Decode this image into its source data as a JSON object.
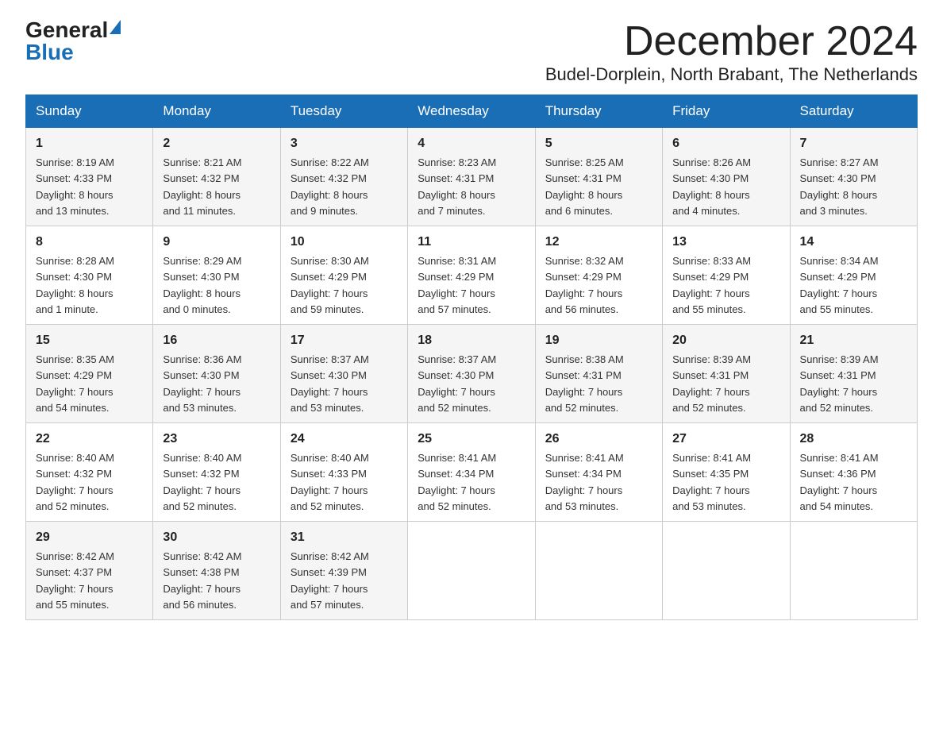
{
  "header": {
    "logo_general": "General",
    "logo_blue": "Blue",
    "month_title": "December 2024",
    "location": "Budel-Dorplein, North Brabant, The Netherlands"
  },
  "days_of_week": [
    "Sunday",
    "Monday",
    "Tuesday",
    "Wednesday",
    "Thursday",
    "Friday",
    "Saturday"
  ],
  "weeks": [
    [
      {
        "day": "1",
        "info": "Sunrise: 8:19 AM\nSunset: 4:33 PM\nDaylight: 8 hours\nand 13 minutes."
      },
      {
        "day": "2",
        "info": "Sunrise: 8:21 AM\nSunset: 4:32 PM\nDaylight: 8 hours\nand 11 minutes."
      },
      {
        "day": "3",
        "info": "Sunrise: 8:22 AM\nSunset: 4:32 PM\nDaylight: 8 hours\nand 9 minutes."
      },
      {
        "day": "4",
        "info": "Sunrise: 8:23 AM\nSunset: 4:31 PM\nDaylight: 8 hours\nand 7 minutes."
      },
      {
        "day": "5",
        "info": "Sunrise: 8:25 AM\nSunset: 4:31 PM\nDaylight: 8 hours\nand 6 minutes."
      },
      {
        "day": "6",
        "info": "Sunrise: 8:26 AM\nSunset: 4:30 PM\nDaylight: 8 hours\nand 4 minutes."
      },
      {
        "day": "7",
        "info": "Sunrise: 8:27 AM\nSunset: 4:30 PM\nDaylight: 8 hours\nand 3 minutes."
      }
    ],
    [
      {
        "day": "8",
        "info": "Sunrise: 8:28 AM\nSunset: 4:30 PM\nDaylight: 8 hours\nand 1 minute."
      },
      {
        "day": "9",
        "info": "Sunrise: 8:29 AM\nSunset: 4:30 PM\nDaylight: 8 hours\nand 0 minutes."
      },
      {
        "day": "10",
        "info": "Sunrise: 8:30 AM\nSunset: 4:29 PM\nDaylight: 7 hours\nand 59 minutes."
      },
      {
        "day": "11",
        "info": "Sunrise: 8:31 AM\nSunset: 4:29 PM\nDaylight: 7 hours\nand 57 minutes."
      },
      {
        "day": "12",
        "info": "Sunrise: 8:32 AM\nSunset: 4:29 PM\nDaylight: 7 hours\nand 56 minutes."
      },
      {
        "day": "13",
        "info": "Sunrise: 8:33 AM\nSunset: 4:29 PM\nDaylight: 7 hours\nand 55 minutes."
      },
      {
        "day": "14",
        "info": "Sunrise: 8:34 AM\nSunset: 4:29 PM\nDaylight: 7 hours\nand 55 minutes."
      }
    ],
    [
      {
        "day": "15",
        "info": "Sunrise: 8:35 AM\nSunset: 4:29 PM\nDaylight: 7 hours\nand 54 minutes."
      },
      {
        "day": "16",
        "info": "Sunrise: 8:36 AM\nSunset: 4:30 PM\nDaylight: 7 hours\nand 53 minutes."
      },
      {
        "day": "17",
        "info": "Sunrise: 8:37 AM\nSunset: 4:30 PM\nDaylight: 7 hours\nand 53 minutes."
      },
      {
        "day": "18",
        "info": "Sunrise: 8:37 AM\nSunset: 4:30 PM\nDaylight: 7 hours\nand 52 minutes."
      },
      {
        "day": "19",
        "info": "Sunrise: 8:38 AM\nSunset: 4:31 PM\nDaylight: 7 hours\nand 52 minutes."
      },
      {
        "day": "20",
        "info": "Sunrise: 8:39 AM\nSunset: 4:31 PM\nDaylight: 7 hours\nand 52 minutes."
      },
      {
        "day": "21",
        "info": "Sunrise: 8:39 AM\nSunset: 4:31 PM\nDaylight: 7 hours\nand 52 minutes."
      }
    ],
    [
      {
        "day": "22",
        "info": "Sunrise: 8:40 AM\nSunset: 4:32 PM\nDaylight: 7 hours\nand 52 minutes."
      },
      {
        "day": "23",
        "info": "Sunrise: 8:40 AM\nSunset: 4:32 PM\nDaylight: 7 hours\nand 52 minutes."
      },
      {
        "day": "24",
        "info": "Sunrise: 8:40 AM\nSunset: 4:33 PM\nDaylight: 7 hours\nand 52 minutes."
      },
      {
        "day": "25",
        "info": "Sunrise: 8:41 AM\nSunset: 4:34 PM\nDaylight: 7 hours\nand 52 minutes."
      },
      {
        "day": "26",
        "info": "Sunrise: 8:41 AM\nSunset: 4:34 PM\nDaylight: 7 hours\nand 53 minutes."
      },
      {
        "day": "27",
        "info": "Sunrise: 8:41 AM\nSunset: 4:35 PM\nDaylight: 7 hours\nand 53 minutes."
      },
      {
        "day": "28",
        "info": "Sunrise: 8:41 AM\nSunset: 4:36 PM\nDaylight: 7 hours\nand 54 minutes."
      }
    ],
    [
      {
        "day": "29",
        "info": "Sunrise: 8:42 AM\nSunset: 4:37 PM\nDaylight: 7 hours\nand 55 minutes."
      },
      {
        "day": "30",
        "info": "Sunrise: 8:42 AM\nSunset: 4:38 PM\nDaylight: 7 hours\nand 56 minutes."
      },
      {
        "day": "31",
        "info": "Sunrise: 8:42 AM\nSunset: 4:39 PM\nDaylight: 7 hours\nand 57 minutes."
      },
      {
        "day": "",
        "info": ""
      },
      {
        "day": "",
        "info": ""
      },
      {
        "day": "",
        "info": ""
      },
      {
        "day": "",
        "info": ""
      }
    ]
  ]
}
